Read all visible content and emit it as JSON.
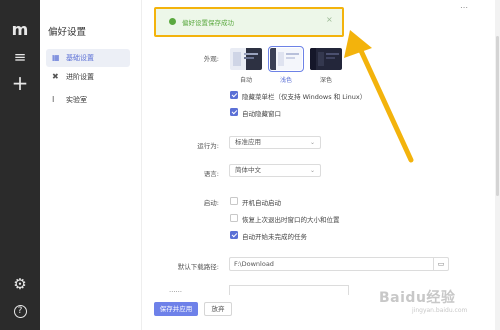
{
  "app": {
    "logo": "m",
    "sidebar_title": "偏好设置",
    "nav": [
      {
        "label": "基础设置",
        "icon": "grid-icon"
      },
      {
        "label": "进阶设置",
        "icon": "tools-icon"
      },
      {
        "label": "实验室",
        "icon": "flask-icon"
      }
    ]
  },
  "toast": {
    "message": "偏好设置保存成功",
    "close": "×"
  },
  "window_controls": {
    "more": "⋯"
  },
  "appearance": {
    "label": "外观:",
    "themes": [
      "自动",
      "浅色",
      "深色"
    ],
    "selected": "浅色"
  },
  "checks_appearance": [
    {
      "label": "隐藏菜单栏（仅支持 Windows 和 Linux）",
      "checked": true
    },
    {
      "label": "自动隐藏窗口",
      "checked": true
    }
  ],
  "run_mode": {
    "label": "运行为:",
    "value": "标准应用"
  },
  "language": {
    "label": "语言:",
    "value": "简体中文"
  },
  "startup": {
    "label": "启动:",
    "items": [
      {
        "label": "开机自动启动",
        "checked": false
      },
      {
        "label": "恢复上次退出时窗口的大小和位置",
        "checked": false
      },
      {
        "label": "自动开始未完成的任务",
        "checked": true
      }
    ]
  },
  "download_path": {
    "label": "默认下载路径:",
    "value": "F:\\Download"
  },
  "buttons": {
    "save_apply": "保存并应用",
    "discard": "放弃"
  },
  "watermark": {
    "text": "Baidu经验",
    "sub": "jingyan.baidu.com"
  },
  "colors": {
    "accent": "#5b70d6",
    "toast_border": "#f3b30c",
    "success": "#5aa93f",
    "leftbar": "#2b2b2b"
  }
}
